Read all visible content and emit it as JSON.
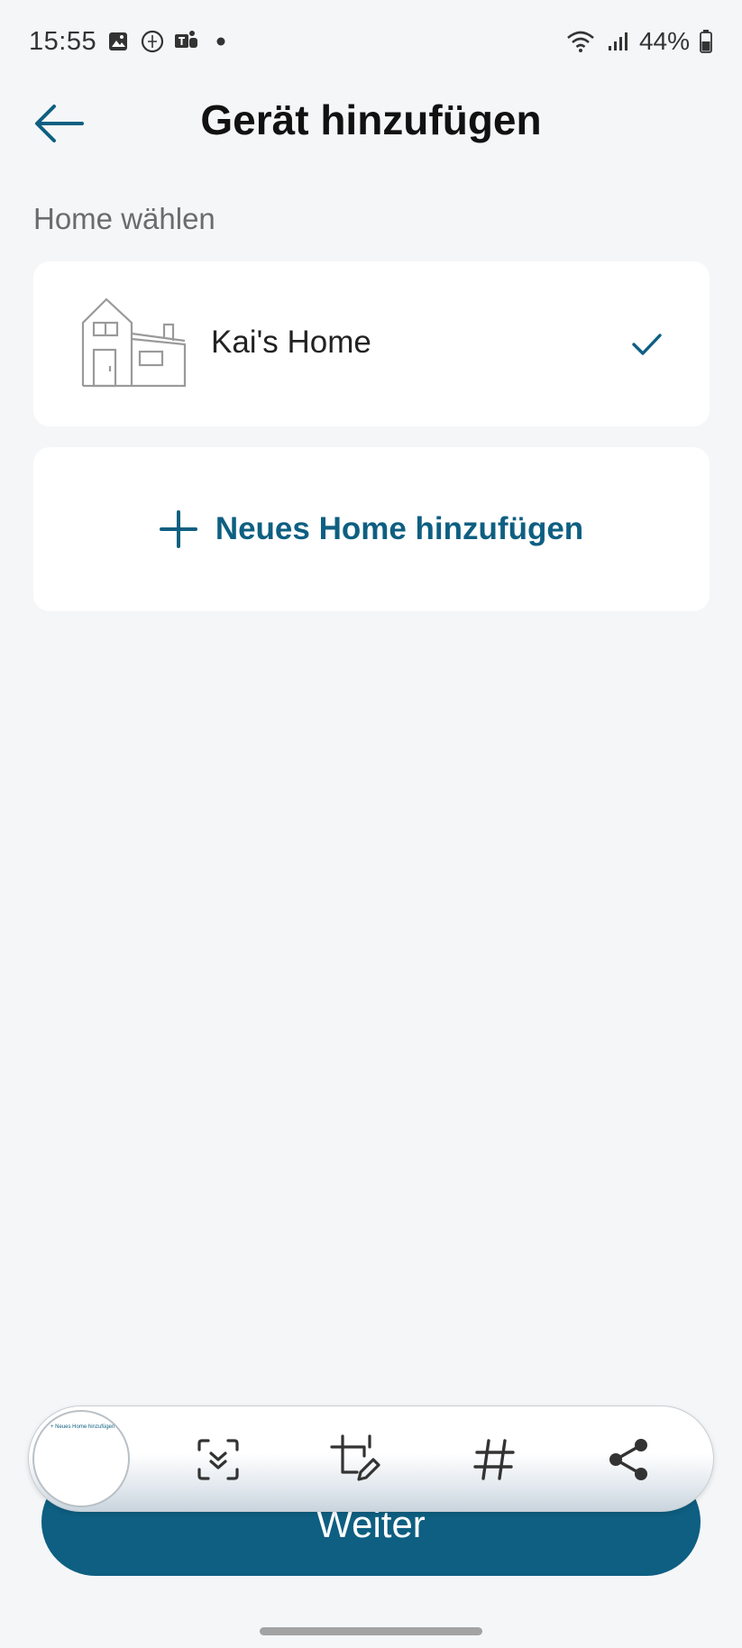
{
  "status_bar": {
    "time": "15:55",
    "battery": "44%",
    "icons": [
      "gallery-icon",
      "vpn-globe-icon",
      "teams-icon",
      "notification-dot-icon",
      "wifi-icon",
      "signal-icon",
      "battery-icon"
    ]
  },
  "header": {
    "title": "Gerät hinzufügen",
    "back_icon": "arrow-left-icon"
  },
  "home_section": {
    "label": "Home wählen",
    "homes": [
      {
        "name": "Kai's Home",
        "selected": true,
        "icon": "house-icon"
      }
    ],
    "add_home_label": "Neues Home hinzufügen"
  },
  "screenshot_toolbar": {
    "thumb_caption": "+ Neues Home hinzufügen",
    "buttons": [
      "scroll-capture-icon",
      "crop-edit-icon",
      "hashtag-icon",
      "share-icon"
    ]
  },
  "footer": {
    "continue_label": "Weiter"
  },
  "colors": {
    "accent": "#0e5f82",
    "background": "#f5f6f8",
    "card": "#ffffff"
  }
}
